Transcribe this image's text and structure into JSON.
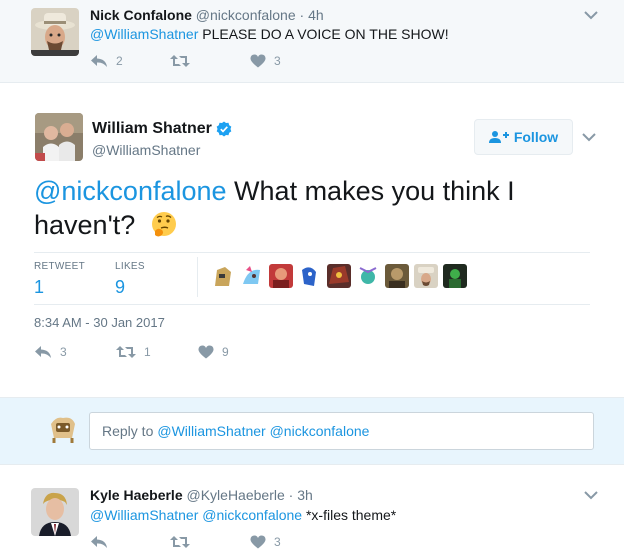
{
  "context_tweet": {
    "name": "Nick Confalone",
    "handle": "@nickconfalone",
    "time": "4h",
    "mention": "@WilliamShatner",
    "text": "PLEASE DO A VOICE ON THE SHOW!",
    "reply_count": "2",
    "retweet_count": "",
    "like_count": "3"
  },
  "main_tweet": {
    "name": "William Shatner",
    "handle": "@WilliamShatner",
    "follow_label": "Follow",
    "mention": "@nickconfalone",
    "text_line1": "What makes you think I",
    "text_line2": "haven't?",
    "retweets_label": "RETWEET",
    "retweets_value": "1",
    "likes_label": "LIKES",
    "likes_value": "9",
    "timestamp": "8:34 AM - 30 Jan 2017",
    "reply_count": "3",
    "retweet_count": "1",
    "like_count": "9"
  },
  "reply_box": {
    "placeholder_prefix": "Reply to ",
    "placeholder_mentions": "@WilliamShatner @nickconfalone"
  },
  "bottom_reply": {
    "name": "Kyle Haeberle",
    "handle": "@KyleHaeberle",
    "time": "3h",
    "mention1": "@WilliamShatner",
    "mention2": "@nickconfalone",
    "text": "*x-files theme*",
    "reply_count": "",
    "retweet_count": "",
    "like_count": "3"
  },
  "colors": {
    "link_blue": "#1b95e0",
    "muted": "#657786",
    "icon_grey": "#8899a6",
    "context_bg": "#f5f8fa",
    "reply_bg": "#e8f5fd"
  },
  "icons": [
    "reply-icon",
    "retweet-icon",
    "heart-icon",
    "chevron-down-icon",
    "verified-badge-icon",
    "follow-person-icon",
    "thinking-face-emoji"
  ]
}
